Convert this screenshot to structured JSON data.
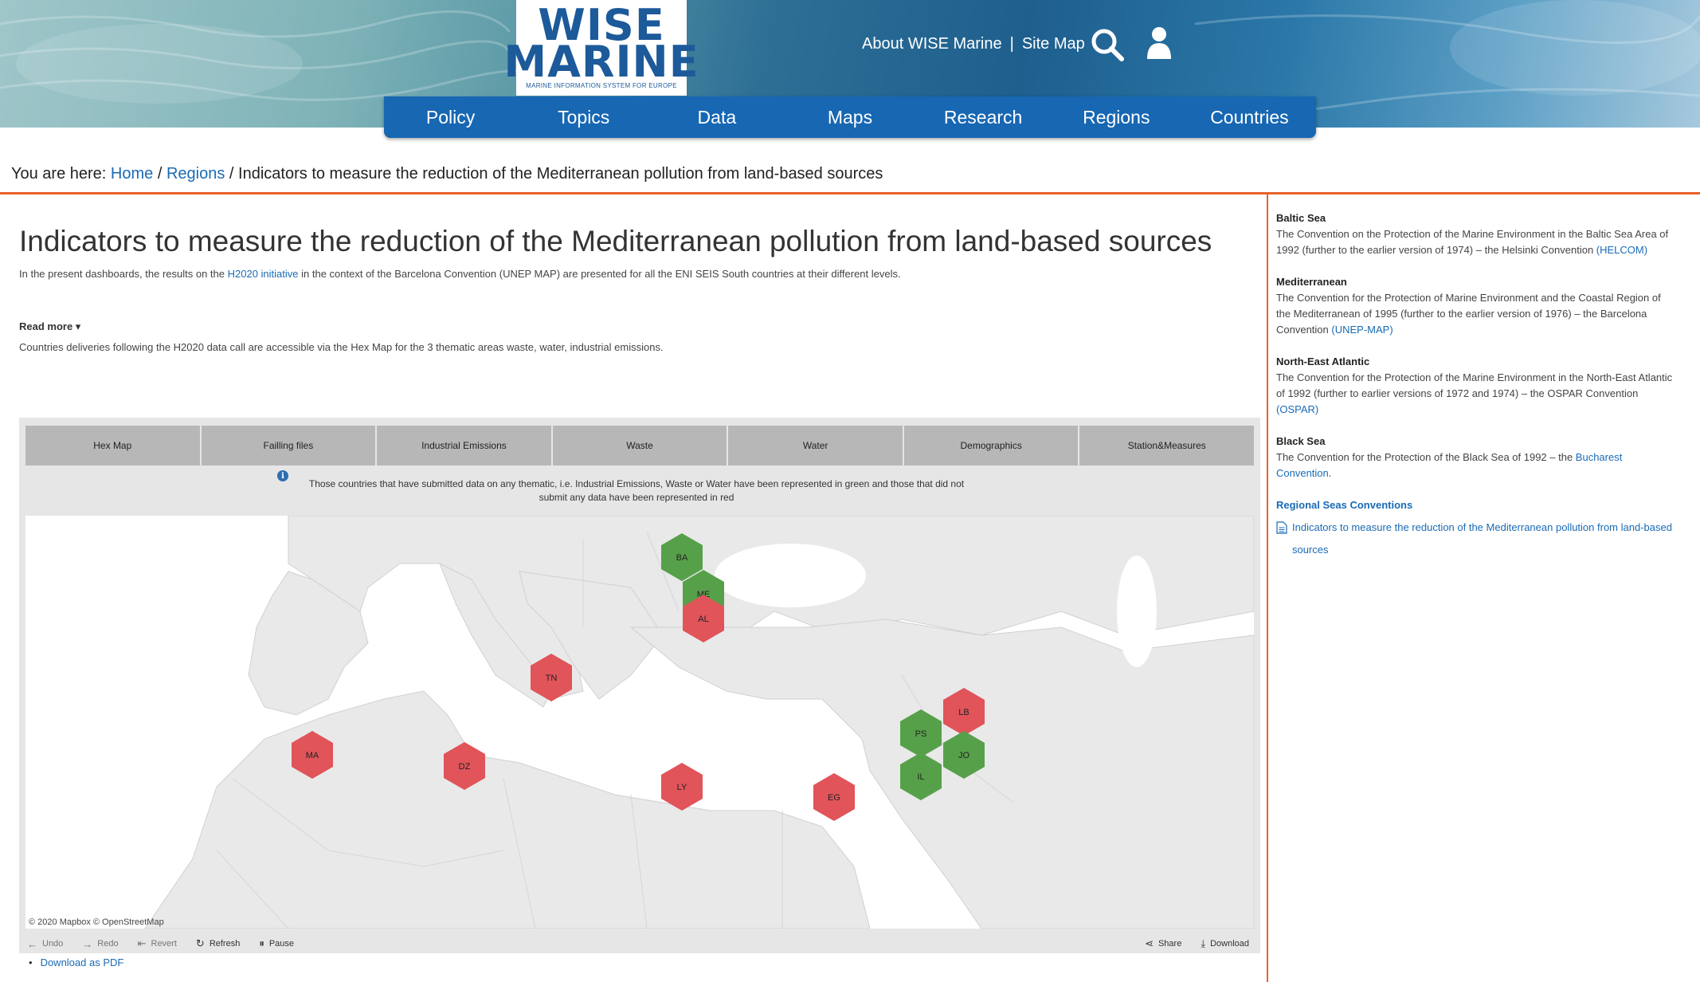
{
  "header": {
    "logo_word_1": "WISE",
    "logo_word_2": "MARINE",
    "logo_tagline": "MARINE INFORMATION SYSTEM FOR EUROPE",
    "links": [
      "About WISE Marine",
      "Site Map"
    ],
    "link_separator": "|",
    "icons": [
      "search-icon",
      "user-icon"
    ]
  },
  "nav": {
    "items": [
      "Policy",
      "Topics",
      "Data",
      "Maps",
      "Research",
      "Regions",
      "Countries"
    ]
  },
  "breadcrumb": {
    "prefix": "You are here:",
    "home": "Home",
    "regions": "Regions",
    "current": "Indicators to measure the reduction of the Mediterranean pollution from land-based sources",
    "separator": "/"
  },
  "main": {
    "title": "Indicators to measure the reduction of the Mediterranean pollution from land-based sources",
    "intro_before": "In the present dashboards, the results on the ",
    "intro_link": "H2020 initiative",
    "intro_after": " in the context of the Barcelona Convention (UNEP MAP) are presented for all the ENI SEIS South countries at their different levels.",
    "read_more": "Read more ▾",
    "deliveries": "Countries deliveries following the H2020 data call are accessible via the Hex Map for the 3 thematic areas waste, water, industrial emissions.",
    "download_pdf": "Download as PDF"
  },
  "dashboard": {
    "tabs": [
      "Hex Map",
      "Failling files",
      "Industrial Emissions",
      "Waste",
      "Water",
      "Demographics",
      "Station&Measures"
    ],
    "info_glyph": "i",
    "note": "Those countries that have submitted data on any thematic, i.e. Industrial Emissions, Waste or Water have been represented in green and those that did not submit any data have been represented in red",
    "map_credit": "© 2020 Mapbox  © OpenStreetMap",
    "colors": {
      "submitted": "#57a04a",
      "not_submitted": "#e0545a"
    },
    "hexes": [
      {
        "code": "BA",
        "status": "submitted"
      },
      {
        "code": "ME",
        "status": "submitted"
      },
      {
        "code": "AL",
        "status": "not_submitted"
      },
      {
        "code": "TN",
        "status": "not_submitted"
      },
      {
        "code": "LB",
        "status": "not_submitted"
      },
      {
        "code": "PS",
        "status": "submitted"
      },
      {
        "code": "JO",
        "status": "submitted"
      },
      {
        "code": "IL",
        "status": "submitted"
      },
      {
        "code": "MA",
        "status": "not_submitted"
      },
      {
        "code": "DZ",
        "status": "not_submitted"
      },
      {
        "code": "LY",
        "status": "not_submitted"
      },
      {
        "code": "EG",
        "status": "not_submitted"
      }
    ],
    "toolbar": {
      "undo": "Undo",
      "redo": "Redo",
      "revert": "Revert",
      "refresh": "Refresh",
      "pause": "Pause",
      "share": "Share",
      "download": "Download"
    }
  },
  "sidebar": {
    "baltic_title": "Baltic Sea",
    "baltic_text": "The Convention on the Protection of the Marine Environment in the Baltic Sea Area of 1992 (further to the earlier version of 1974) – the Helsinki Convention ",
    "baltic_link": "(HELCOM)",
    "med_title": "Mediterranean",
    "med_text": "The Convention for the Protection of Marine Environment and the Coastal Region of the Mediterranean of 1995 (further to the earlier version of 1976) – the Barcelona Convention ",
    "med_link": "(UNEP-MAP)",
    "nea_title": "North-East Atlantic",
    "nea_text": "The Convention for the Protection of the Marine Environment in the North-East Atlantic of 1992 (further to earlier versions of 1972 and 1974) – the OSPAR Convention ",
    "nea_link": "(OSPAR)",
    "black_title": "Black Sea",
    "black_text": "The Convention for the Protection of the Black Sea of 1992 – the ",
    "black_link": "Bucharest Convention",
    "black_after": ".",
    "rsc_title": "Regional Seas Conventions",
    "rsc_doc": "Indicators to measure the reduction of the Mediterranean pollution from land-based sources"
  }
}
